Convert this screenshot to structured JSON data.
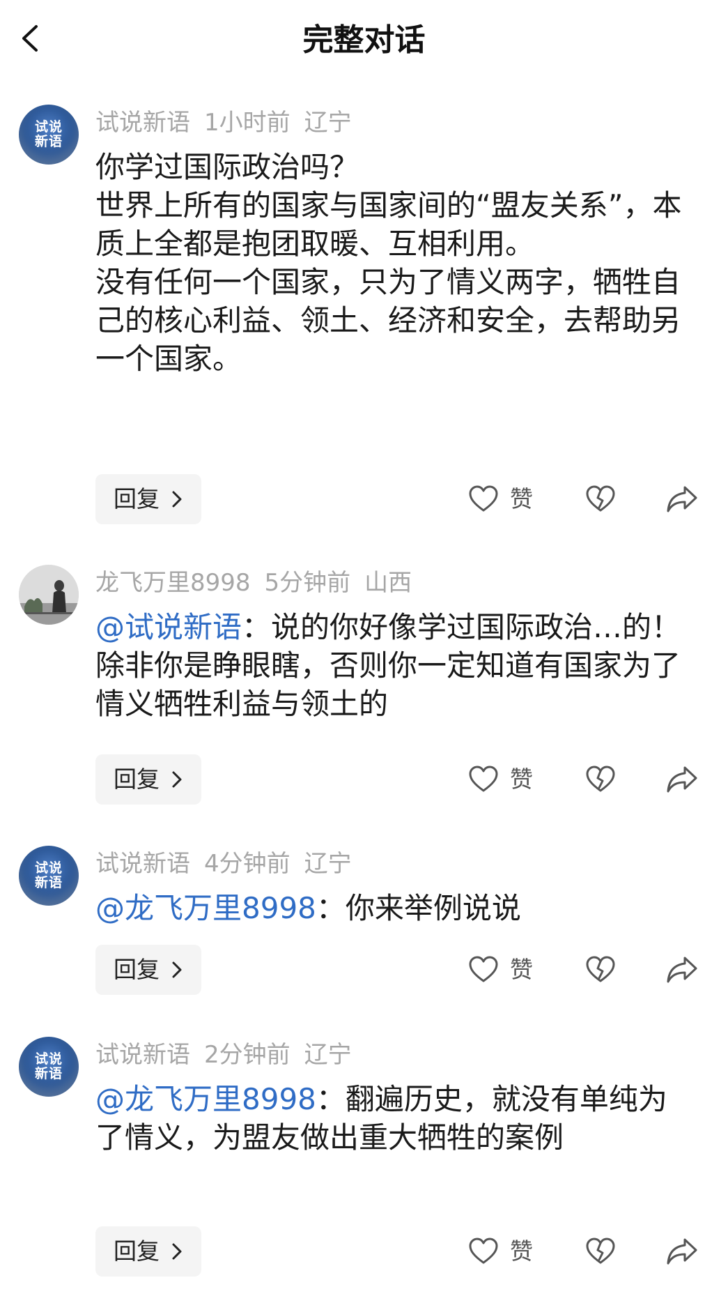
{
  "header": {
    "title": "完整对话",
    "back_icon": "chevron-left-icon"
  },
  "colors": {
    "mention": "#2f6cc5",
    "meta": "#a6a6a6",
    "text": "#1a1a1a"
  },
  "comments": [
    {
      "author": "试说新语",
      "time": "1小时前",
      "location": "辽宁",
      "avatar_text": [
        "试说",
        "新语"
      ],
      "paragraphs": [
        "你学过国际政治吗？",
        "世界上所有的国家与国家间的“盟友关系”，本质上全都是抱团取暖、互相利用。",
        "没有任何一个国家，只为了情义两字，牺牲自己的核心利益、领土、经济和安全，去帮助另一个国家。"
      ],
      "reply_label": "回复",
      "like_label": "赞"
    },
    {
      "author": "龙飞万里8998",
      "time": "5分钟前",
      "location": "山西",
      "mention": "@试说新语",
      "body": "：说的你好像学过国际政治…的！除非你是睁眼瞎，否则你一定知道有国家为了情义牺牲利益与领土的",
      "reply_label": "回复",
      "like_label": "赞"
    },
    {
      "author": "试说新语",
      "time": "4分钟前",
      "location": "辽宁",
      "avatar_text": [
        "试说",
        "新语"
      ],
      "mention": "@龙飞万里8998",
      "body": "：你来举例说说",
      "reply_label": "回复",
      "like_label": "赞"
    },
    {
      "author": "试说新语",
      "time": "2分钟前",
      "location": "辽宁",
      "avatar_text": [
        "试说",
        "新语"
      ],
      "mention": "@龙飞万里8998",
      "body": "：翻遍历史，就没有单纯为了情义，为盟友做出重大牺牲的案例",
      "reply_label": "回复",
      "like_label": "赞"
    }
  ]
}
